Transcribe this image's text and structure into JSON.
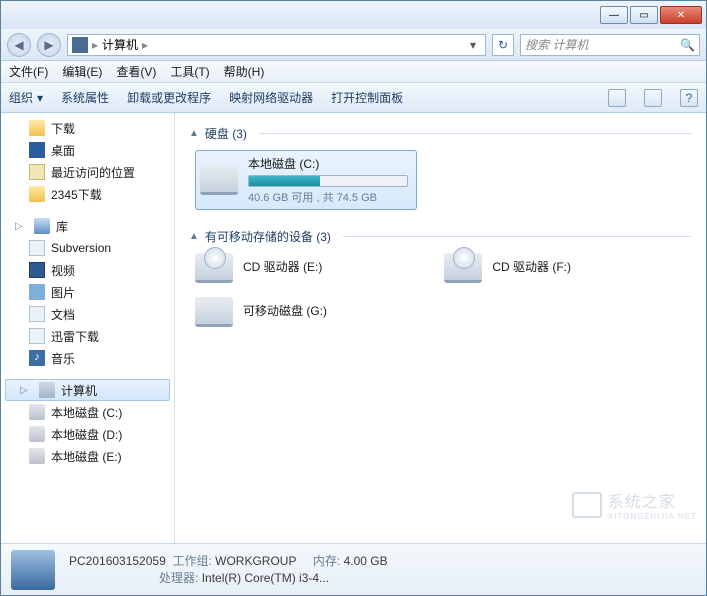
{
  "titlebar": {
    "min": "—",
    "max": "▭",
    "close": "✕"
  },
  "nav": {
    "back": "◀",
    "fwd": "▶",
    "address_icon": "computer-icon",
    "address": "计算机",
    "sep": "▸",
    "dropdown": "▾",
    "refresh": "↻",
    "search_placeholder": "搜索 计算机",
    "search_icon": "🔍"
  },
  "menu": {
    "file": "文件(F)",
    "edit": "编辑(E)",
    "view": "查看(V)",
    "tools": "工具(T)",
    "help": "帮助(H)"
  },
  "toolbar": {
    "organize": "组织",
    "organize_arrow": "▾",
    "props": "系统属性",
    "uninstall": "卸载或更改程序",
    "mapdrive": "映射网络驱动器",
    "cpanel": "打开控制面板"
  },
  "sidebar": {
    "downloads": "下载",
    "desktop": "桌面",
    "recent": "最近访问的位置",
    "folder2345": "2345下载",
    "libraries": "库",
    "subversion": "Subversion",
    "videos": "视频",
    "pictures": "图片",
    "documents": "文档",
    "thunder": "迅雷下载",
    "music": "音乐",
    "computer": "计算机",
    "drive_c": "本地磁盘 (C:)",
    "drive_d": "本地磁盘 (D:)",
    "drive_e": "本地磁盘 (E:)"
  },
  "content": {
    "hdd_group": "硬盘 (3)",
    "removable_group": "有可移动存储的设备 (3)",
    "drive_c": {
      "name": "本地磁盘 (C:)",
      "free_text": "40.6 GB 可用 , 共 74.5 GB",
      "fill_pct": 45
    },
    "cd_e": "CD 驱动器 (E:)",
    "cd_f": "CD 驱动器 (F:)",
    "rem_g": "可移动磁盘 (G:)"
  },
  "status": {
    "name": "PC201603152059",
    "workgroup_lbl": "工作组:",
    "workgroup": "WORKGROUP",
    "mem_lbl": "内存:",
    "mem": "4.00 GB",
    "cpu_lbl": "处理器:",
    "cpu": "Intel(R) Core(TM) i3-4..."
  },
  "watermark": {
    "text": "系统之家",
    "sub": "XITONGZHIJIA.NET"
  }
}
